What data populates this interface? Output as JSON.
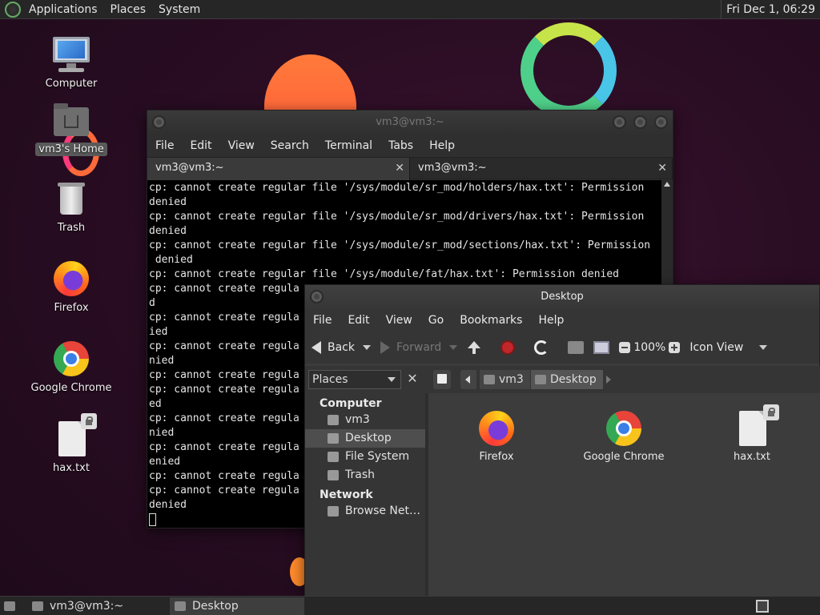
{
  "top_panel": {
    "menus": [
      "Applications",
      "Places",
      "System"
    ],
    "clock": "Fri Dec 1, 06:29"
  },
  "desktop": {
    "icons": [
      {
        "label": "Computer",
        "icon": "computer-icon"
      },
      {
        "label": "vm3's Home",
        "icon": "home-folder-icon"
      },
      {
        "label": "Trash",
        "icon": "trash-icon"
      },
      {
        "label": "Firefox",
        "icon": "firefox-icon"
      },
      {
        "label": "Google Chrome",
        "icon": "chrome-icon"
      },
      {
        "label": "hax.txt",
        "icon": "text-file-icon"
      }
    ]
  },
  "terminal": {
    "title": "vm3@vm3:~",
    "menu": [
      "File",
      "Edit",
      "View",
      "Search",
      "Terminal",
      "Tabs",
      "Help"
    ],
    "tabs": [
      "vm3@vm3:~",
      "vm3@vm3:~"
    ],
    "lines": [
      "cp: cannot create regular file '/sys/module/sr_mod/holders/hax.txt': Permission",
      "denied",
      "cp: cannot create regular file '/sys/module/sr_mod/drivers/hax.txt': Permission",
      "denied",
      "cp: cannot create regular file '/sys/module/sr_mod/sections/hax.txt': Permission",
      " denied",
      "cp: cannot create regular file '/sys/module/fat/hax.txt': Permission denied",
      "cp: cannot create regula",
      "d",
      "cp: cannot create regula",
      "ied",
      "cp: cannot create regula",
      "nied",
      "cp: cannot create regula",
      "cp: cannot create regula",
      "ed",
      "cp: cannot create regula",
      "nied",
      "cp: cannot create regula",
      "enied",
      "cp: cannot create regula",
      "cp: cannot create regula",
      "denied"
    ]
  },
  "file_manager": {
    "title": "Desktop",
    "menu": [
      "File",
      "Edit",
      "View",
      "Go",
      "Bookmarks",
      "Help"
    ],
    "toolbar": {
      "back": "Back",
      "forward": "Forward",
      "zoom": "100%",
      "view_mode": "Icon View"
    },
    "places_combo": "Places",
    "breadcrumbs": [
      "vm3",
      "Desktop"
    ],
    "sidebar": {
      "computer_header": "Computer",
      "computer_items": [
        "vm3",
        "Desktop",
        "File System",
        "Trash"
      ],
      "network_header": "Network",
      "network_items": [
        "Browse Net…"
      ]
    },
    "files": [
      "Firefox",
      "Google Chrome",
      "hax.txt"
    ]
  },
  "taskbar": {
    "tasks": [
      "vm3@vm3:~",
      "Desktop"
    ]
  }
}
